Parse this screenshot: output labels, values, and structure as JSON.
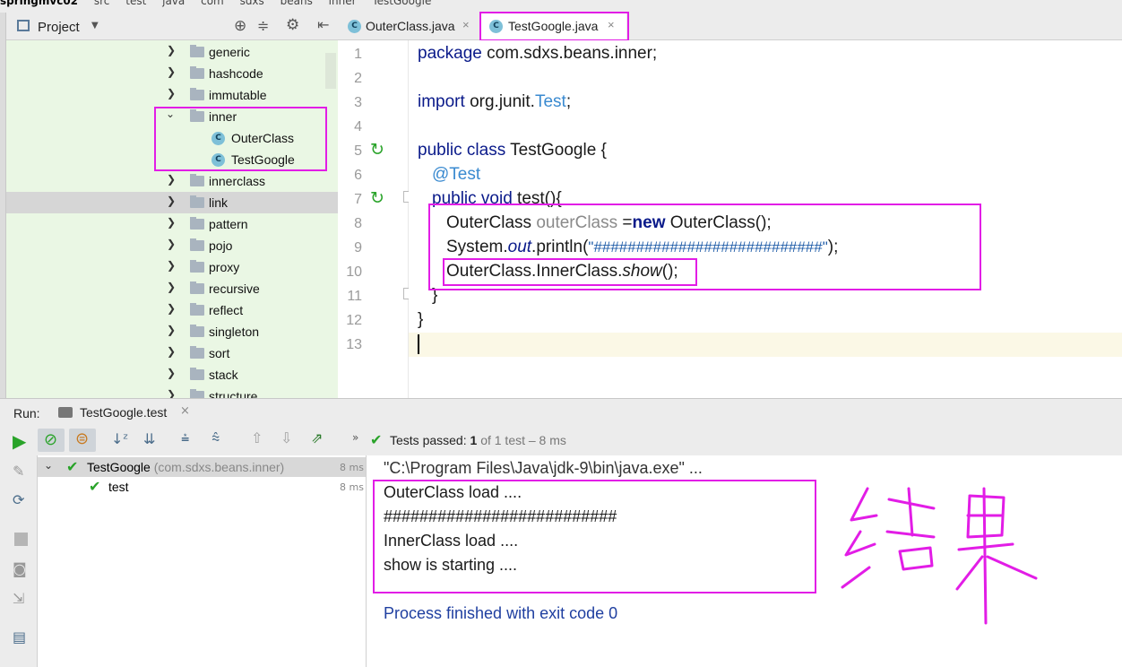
{
  "breadcrumb": [
    "springmvc02",
    "src",
    "test",
    "java",
    "com",
    "sdxs",
    "beans",
    "inner",
    "TestGoogle"
  ],
  "project": {
    "title": "Project",
    "items": [
      {
        "label": "generic"
      },
      {
        "label": "hashcode"
      },
      {
        "label": "immutable"
      },
      {
        "label": "inner"
      },
      {
        "label": "OuterClass"
      },
      {
        "label": "TestGoogle"
      },
      {
        "label": "innerclass"
      },
      {
        "label": "link"
      },
      {
        "label": "pattern"
      },
      {
        "label": "pojo"
      },
      {
        "label": "proxy"
      },
      {
        "label": "recursive"
      },
      {
        "label": "reflect"
      },
      {
        "label": "singleton"
      },
      {
        "label": "sort"
      },
      {
        "label": "stack"
      },
      {
        "label": "structure"
      }
    ]
  },
  "editor": {
    "tabs": [
      {
        "label": "OuterClass.java",
        "icon": "class-icon"
      },
      {
        "label": "TestGoogle.java",
        "icon": "test-class-icon",
        "active": true
      }
    ],
    "line_numbers": [
      "1",
      "2",
      "3",
      "4",
      "5",
      "6",
      "7",
      "8",
      "9",
      "10",
      "11",
      "12",
      "13"
    ],
    "lines": {
      "l1_kw": "package",
      "l1_rest": " com.sdxs.beans.inner;",
      "l3_kw": "import",
      "l3_pkg": " org.junit.",
      "l3_cls": "Test",
      "l3_end": ";",
      "l5_kw": "public class",
      "l5_rest": " TestGoogle {",
      "l6_ann": "@Test",
      "l7_kw": "public void",
      "l7_rest": " test(){",
      "l8_a": "OuterClass ",
      "l8_var": "outerClass",
      "l8_b": " =",
      "l8_new": "new",
      "l8_c": " OuterClass();",
      "l9_a": "System.",
      "l9_out": "out",
      "l9_b": ".println(",
      "l9_str": "\"###########################\"",
      "l9_c": ");",
      "l10_a": "OuterClass.InnerClass.",
      "l10_show": "show",
      "l10_b": "();",
      "l11": "}",
      "l12": "}"
    }
  },
  "run": {
    "label": "Run:",
    "tab": "TestGoogle.test",
    "status_prefix": "Tests passed:",
    "status_count": "1",
    "status_rest": "of 1 test – 8 ms",
    "tree": [
      {
        "name": "TestGoogle",
        "detail": "(com.sdxs.beans.inner)",
        "time": "8 ms"
      },
      {
        "name": "test",
        "time": "8 ms"
      }
    ],
    "console": [
      "\"C:\\Program Files\\Java\\jdk-9\\bin\\java.exe\" ...",
      "OuterClass load ....",
      "##########################",
      "InnerClass load ....",
      "show is starting ....",
      "Process finished with exit code 0"
    ]
  },
  "colors": {
    "highlight": "#e21de6",
    "tree_bg": "#eaf7e4",
    "keyword": "#0a1a8a",
    "annotation": "#3a8ad0"
  }
}
